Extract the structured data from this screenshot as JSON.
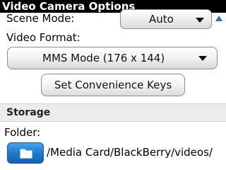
{
  "title": "Video Camera Options",
  "scene_mode": {
    "label": "Scene Mode:",
    "value": "Auto"
  },
  "video_format": {
    "label": "Video Format:",
    "value": "MMS Mode (176 x 144)"
  },
  "convenience_button": {
    "label": "Set Convenience Keys"
  },
  "storage": {
    "header": "Storage",
    "folder_label": "Folder:",
    "folder_path": "/Media Card/BlackBerry/videos/"
  },
  "colors": {
    "titlebar_bg": "#000000",
    "accent_blue": "#1f79cf",
    "section_bg": "#ececec"
  },
  "icons": {
    "dropdown": "chevron-down-icon",
    "scroll": "scroll-up-arrow-icon",
    "folder": "folder-icon"
  }
}
